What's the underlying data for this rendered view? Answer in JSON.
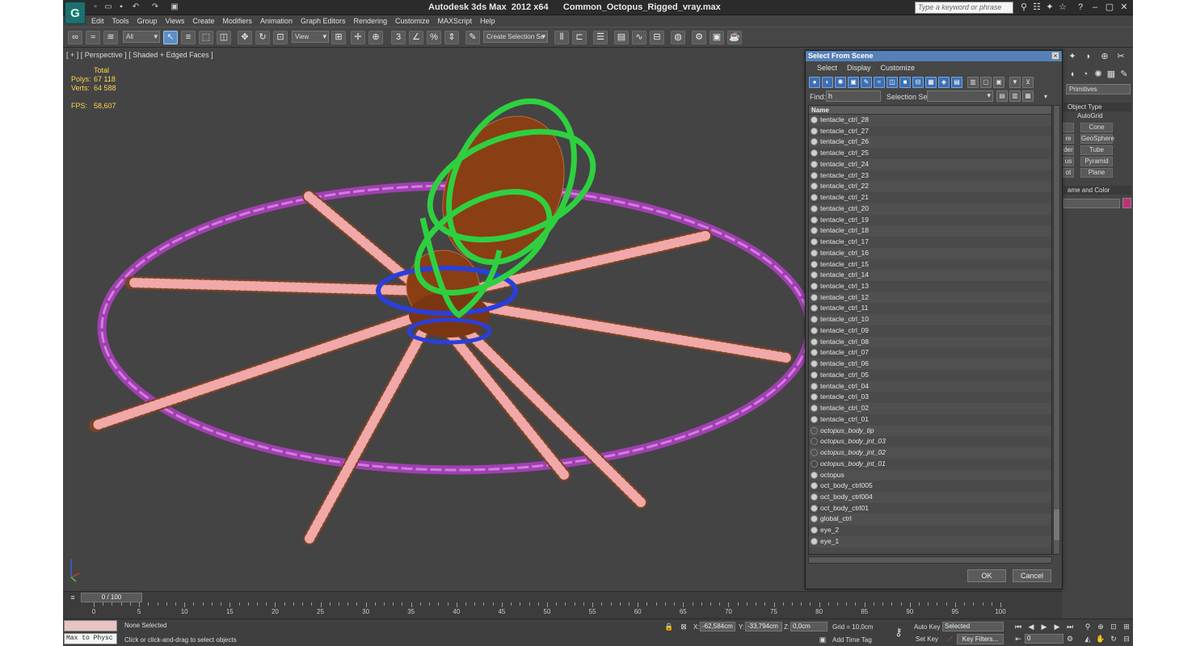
{
  "window": {
    "title": "Autodesk 3ds Max  2012 x64      Common_Octopus_Rigged_vray.max",
    "search_placeholder": "Type a keyword or phrase",
    "logo_icon": "3dsmax-logo-icon"
  },
  "menu": [
    "Edit",
    "Tools",
    "Group",
    "Views",
    "Create",
    "Modifiers",
    "Animation",
    "Graph Editors",
    "Rendering",
    "Customize",
    "MAXScript",
    "Help"
  ],
  "toolbar": {
    "filter_value": "All",
    "ref_coord_value": "View",
    "named_selection_placeholder": "Create Selection Se"
  },
  "viewport": {
    "label": "[ + ] [ Perspective ] [ Shaded + Edged Faces ]",
    "stats": {
      "total_label": "Total",
      "polys_label": "Polys:",
      "polys_value": "67 118",
      "verts_label": "Verts:",
      "verts_value": "64 588",
      "fps_label": "FPS:",
      "fps_value": "58,607"
    }
  },
  "command_panel": {
    "dropdown": "Primitives",
    "object_type_label": "Object Type",
    "autogrid_label": "AutoGrid",
    "buttons": [
      "",
      "Cone",
      "re",
      "GeoSphere",
      "der",
      "Tube",
      "us",
      "Pyramid",
      "ot",
      "Plane"
    ],
    "name_color_label": "ame and Color",
    "accent_color": "#c0307a"
  },
  "dialog": {
    "title": "Select From Scene",
    "menu": [
      "Select",
      "Display",
      "Customize"
    ],
    "find_label": "Find:",
    "find_value": "h",
    "selection_set_label": "Selection Set:",
    "column_name": "Name",
    "rows": [
      {
        "name": "tentacle_ctrl_28",
        "type": "shape"
      },
      {
        "name": "tentacle_ctrl_27",
        "type": "shape"
      },
      {
        "name": "tentacle_ctrl_26",
        "type": "shape"
      },
      {
        "name": "tentacle_ctrl_25",
        "type": "shape"
      },
      {
        "name": "tentacle_ctrl_24",
        "type": "shape"
      },
      {
        "name": "tentacle_ctrl_23",
        "type": "shape"
      },
      {
        "name": "tentacle_ctrl_22",
        "type": "shape"
      },
      {
        "name": "tentacle_ctrl_21",
        "type": "shape"
      },
      {
        "name": "tentacle_ctrl_20",
        "type": "shape"
      },
      {
        "name": "tentacle_ctrl_19",
        "type": "shape"
      },
      {
        "name": "tentacle_ctrl_18",
        "type": "shape"
      },
      {
        "name": "tentacle_ctrl_17",
        "type": "shape"
      },
      {
        "name": "tentacle_ctrl_16",
        "type": "shape"
      },
      {
        "name": "tentacle_ctrl_15",
        "type": "shape"
      },
      {
        "name": "tentacle_ctrl_14",
        "type": "shape"
      },
      {
        "name": "tentacle_ctrl_13",
        "type": "shape"
      },
      {
        "name": "tentacle_ctrl_12",
        "type": "shape"
      },
      {
        "name": "tentacle_ctrl_11",
        "type": "shape"
      },
      {
        "name": "tentacle_ctrl_10",
        "type": "shape"
      },
      {
        "name": "tentacle_ctrl_09",
        "type": "shape"
      },
      {
        "name": "tentacle_ctrl_08",
        "type": "shape"
      },
      {
        "name": "tentacle_ctrl_07",
        "type": "shape"
      },
      {
        "name": "tentacle_ctrl_06",
        "type": "shape"
      },
      {
        "name": "tentacle_ctrl_05",
        "type": "shape"
      },
      {
        "name": "tentacle_ctrl_04",
        "type": "shape"
      },
      {
        "name": "tentacle_ctrl_03",
        "type": "shape"
      },
      {
        "name": "tentacle_ctrl_02",
        "type": "shape"
      },
      {
        "name": "tentacle_ctrl_01",
        "type": "shape"
      },
      {
        "name": "octopus_body_tip",
        "type": "helper"
      },
      {
        "name": "octopus_body_jnt_03",
        "type": "helper"
      },
      {
        "name": "octopus_body_jnt_02",
        "type": "helper"
      },
      {
        "name": "octopus_body_jnt_01",
        "type": "helper"
      },
      {
        "name": "octopus",
        "type": "geometry"
      },
      {
        "name": "oct_body_ctrl005",
        "type": "shape"
      },
      {
        "name": "oct_body_ctrl004",
        "type": "shape"
      },
      {
        "name": "oct_body_ctrl01",
        "type": "shape"
      },
      {
        "name": "global_ctrl",
        "type": "shape"
      },
      {
        "name": "eye_2",
        "type": "geometry"
      },
      {
        "name": "eye_1",
        "type": "geometry"
      }
    ],
    "ok_label": "OK",
    "cancel_label": "Cancel"
  },
  "timeline": {
    "slider_label": "0 / 100",
    "ticks": [
      "0",
      "5",
      "10",
      "15",
      "20",
      "25",
      "30",
      "35",
      "40",
      "45",
      "50",
      "55",
      "60",
      "65",
      "70",
      "75",
      "80",
      "85",
      "90",
      "95",
      "100"
    ]
  },
  "status": {
    "maxscript_text": "Max to Physc",
    "selection_text": "None Selected",
    "prompt_text": "Click or click-and-drag to select objects",
    "x_label": "X:",
    "x_value": "-62,584cm",
    "y_label": "Y:",
    "y_value": "-33,794cm",
    "z_label": "Z:",
    "z_value": "0,0cm",
    "grid_text": "Grid = 10,0cm",
    "add_time_tag": "Add Time Tag",
    "auto_key": "Auto Key",
    "set_key": "Set Key",
    "key_mode_value": "Selected",
    "key_filters": "Key Filters...",
    "frame_value": "0"
  }
}
